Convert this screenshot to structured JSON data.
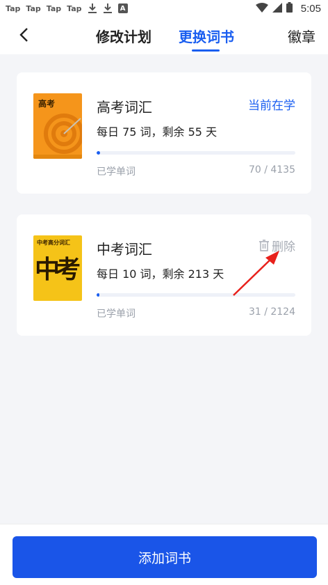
{
  "status_bar": {
    "notifications": [
      "Tap",
      "Tap",
      "Tap",
      "Tap"
    ],
    "time": "5:05",
    "a_badge": "A"
  },
  "nav": {
    "tabs": [
      {
        "label": "修改计划",
        "active": false
      },
      {
        "label": "更换词书",
        "active": true
      },
      {
        "label": "徽章",
        "active": false
      }
    ]
  },
  "books": [
    {
      "name": "高考词汇",
      "cover_title": "高考",
      "plan": "每日 75 词，剩余 55 天",
      "status": "当前在学",
      "learned_label": "已学单词",
      "learned": 70,
      "total": 4135,
      "learned_text": "70 / 4135",
      "progress": 0.017
    },
    {
      "name": "中考词汇",
      "cover_title": "中考高分词汇",
      "cover_big": "中考",
      "plan": "每日 10 词，剩余 213 天",
      "action": "删除",
      "learned_label": "已学单词",
      "learned": 31,
      "total": 2124,
      "learned_text": "31 / 2124",
      "progress": 0.015
    }
  ],
  "bottom": {
    "add_button": "添加词书"
  },
  "colors": {
    "accent": "#1a5ef0",
    "button": "#1a55e8",
    "annotation_arrow": "#e8211c"
  }
}
